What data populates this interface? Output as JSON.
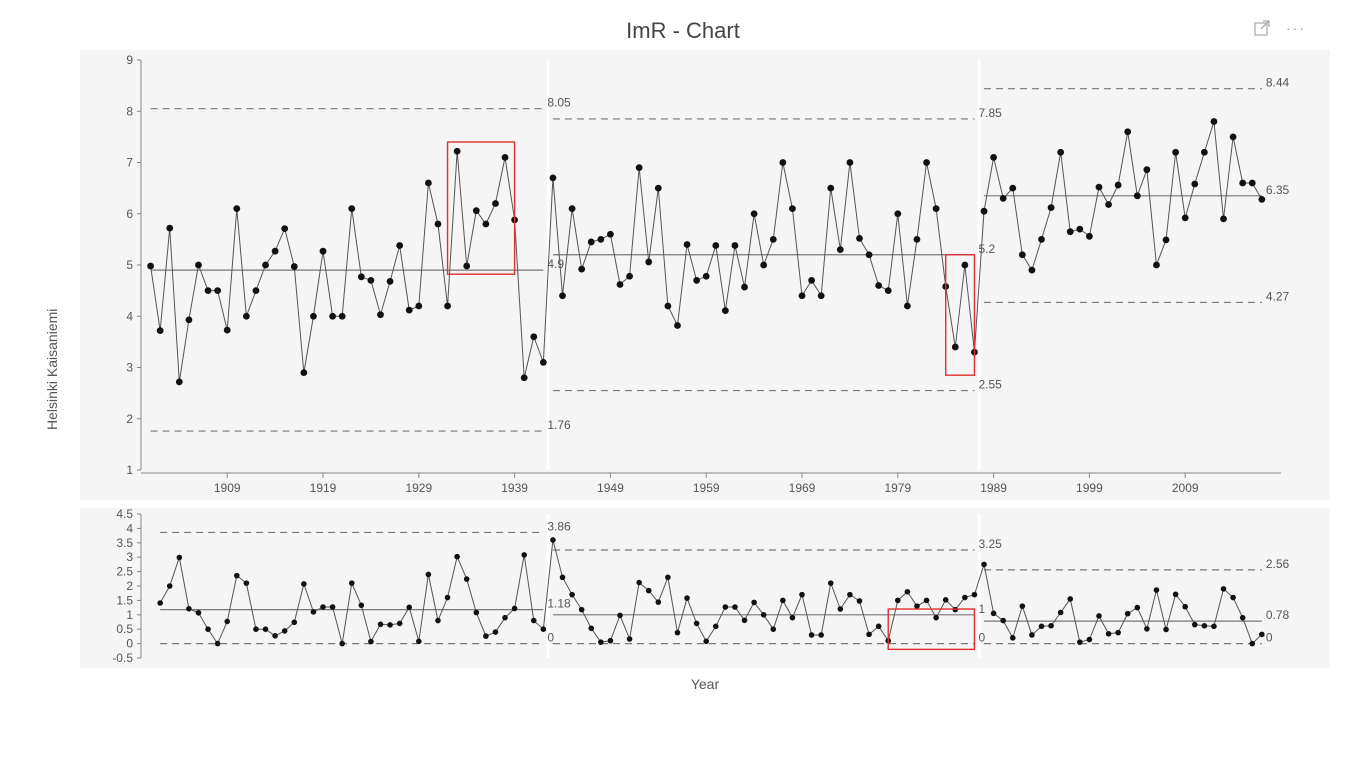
{
  "title": "ImR - Chart",
  "xlabel": "Year",
  "ylabel_top": "Helsinki Kaisaniemi",
  "chart_data": [
    {
      "type": "line",
      "name": "individuals",
      "x_start": 1901,
      "ylim": [
        1,
        9
      ],
      "yticks": [
        1,
        2,
        3,
        4,
        5,
        6,
        7,
        8,
        9
      ],
      "xticks": [
        1909,
        1919,
        1929,
        1939,
        1949,
        1959,
        1969,
        1979,
        1989,
        1999,
        2009
      ],
      "values": [
        4.98,
        3.72,
        5.72,
        2.72,
        3.93,
        5.0,
        4.5,
        4.5,
        3.73,
        6.1,
        4.0,
        4.5,
        5.0,
        5.27,
        5.71,
        4.97,
        2.9,
        4.0,
        5.27,
        4.0,
        4.0,
        6.1,
        4.77,
        4.7,
        4.03,
        4.68,
        5.38,
        4.12,
        4.2,
        6.6,
        5.8,
        4.2,
        7.22,
        4.98,
        6.06,
        5.8,
        6.2,
        7.1,
        5.88,
        2.8,
        3.6,
        3.1,
        6.7,
        4.4,
        6.1,
        4.92,
        5.45,
        5.5,
        5.6,
        4.62,
        4.78,
        6.9,
        5.06,
        6.5,
        4.2,
        3.82,
        5.4,
        4.7,
        4.78,
        5.38,
        4.11,
        5.38,
        4.57,
        6.0,
        5.0,
        5.5,
        7.0,
        6.1,
        4.4,
        4.7,
        4.4,
        6.5,
        5.3,
        7.0,
        5.52,
        5.2,
        4.6,
        4.5,
        6.0,
        4.2,
        5.5,
        7.0,
        6.1,
        4.58,
        3.4,
        5.0,
        3.3,
        6.05,
        7.1,
        6.3,
        6.5,
        5.2,
        4.9,
        5.5,
        6.12,
        7.2,
        5.65,
        5.7,
        5.56,
        6.52,
        6.18,
        6.56,
        7.6,
        6.35,
        6.86,
        5.0,
        5.49,
        7.2,
        5.92,
        6.58,
        7.2,
        7.8,
        5.9,
        7.5,
        6.6,
        6.6,
        6.28
      ],
      "stages": [
        {
          "start": 1901,
          "end": 1942,
          "mean": 4.9,
          "ucl": 8.05,
          "lcl": 1.76
        },
        {
          "start": 1943,
          "end": 1987,
          "mean": 5.2,
          "ucl": 7.85,
          "lcl": 2.55
        },
        {
          "start": 1988,
          "end": 2017,
          "mean": 6.35,
          "ucl": 8.44,
          "lcl": 4.27
        }
      ],
      "highlight_boxes": [
        {
          "x1": 1932,
          "x2": 1939,
          "y1": 4.82,
          "y2": 7.4
        },
        {
          "x1": 1984,
          "x2": 1987,
          "y1": 2.85,
          "y2": 5.2
        }
      ]
    },
    {
      "type": "line",
      "name": "moving_range",
      "x_start": 1902,
      "ylim": [
        -0.5,
        4.5
      ],
      "yticks": [
        -0.5,
        0,
        0.5,
        1,
        1.5,
        2,
        2.5,
        3,
        3.5,
        4,
        4.5
      ],
      "values": [
        1.41,
        2.0,
        2.99,
        1.21,
        1.07,
        0.5,
        0.0,
        0.77,
        2.36,
        2.1,
        0.5,
        0.5,
        0.27,
        0.44,
        0.74,
        2.07,
        1.1,
        1.27,
        1.27,
        0.0,
        2.1,
        1.33,
        0.07,
        0.67,
        0.65,
        0.7,
        1.26,
        0.08,
        2.4,
        0.8,
        1.6,
        3.02,
        2.24,
        1.08,
        0.26,
        0.4,
        0.9,
        1.22,
        3.08,
        0.8,
        0.5,
        3.6,
        2.3,
        1.7,
        1.18,
        0.53,
        0.05,
        0.1,
        0.98,
        0.16,
        2.12,
        1.84,
        1.44,
        2.3,
        0.38,
        1.58,
        0.7,
        0.08,
        0.6,
        1.27,
        1.27,
        0.81,
        1.43,
        1.0,
        0.5,
        1.5,
        0.9,
        1.7,
        0.3,
        0.3,
        2.1,
        1.2,
        1.7,
        1.48,
        0.32,
        0.6,
        0.1,
        1.5,
        1.8,
        1.3,
        1.5,
        0.9,
        1.52,
        1.18,
        1.6,
        1.7,
        2.75,
        1.05,
        0.8,
        0.2,
        1.3,
        0.3,
        0.6,
        0.62,
        1.08,
        1.55,
        0.05,
        0.14,
        0.96,
        0.34,
        0.38,
        1.04,
        1.25,
        0.51,
        1.86,
        0.49,
        1.71,
        1.28,
        0.66,
        0.62,
        0.6,
        1.9,
        1.6,
        0.9,
        0.0,
        0.32
      ],
      "stages": [
        {
          "start": 1902,
          "end": 1942,
          "mean": 1.18,
          "ucl": 3.86,
          "lcl": 0
        },
        {
          "start": 1943,
          "end": 1987,
          "mean": 1.0,
          "ucl": 3.25,
          "lcl": 0
        },
        {
          "start": 1988,
          "end": 2017,
          "mean": 0.78,
          "ucl": 2.56,
          "lcl": 0
        }
      ],
      "highlight_boxes": [
        {
          "x1": 1978,
          "x2": 1987,
          "y1": -0.2,
          "y2": 1.2
        }
      ]
    }
  ]
}
